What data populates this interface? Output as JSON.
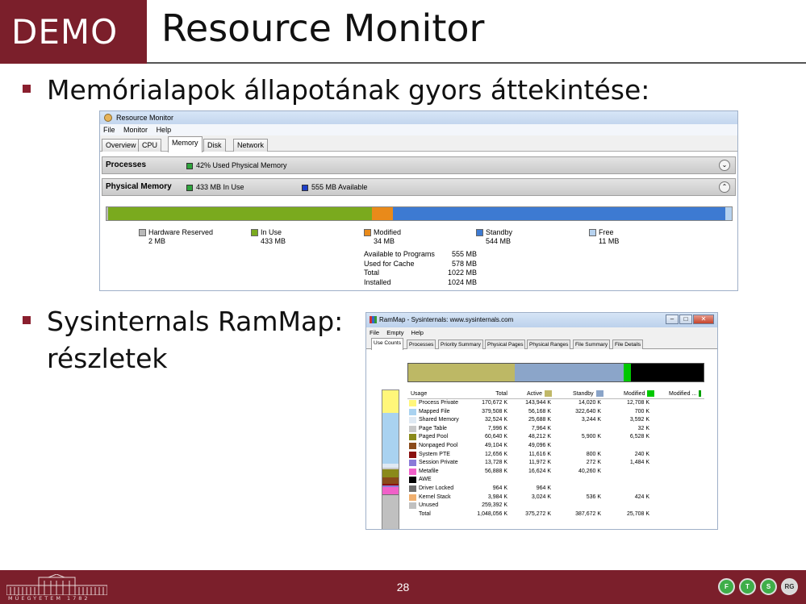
{
  "slide": {
    "demo_label": "DEMO",
    "title": "Resource Monitor",
    "bullet1": "Memórialapok állapotának gyors áttekintése:",
    "bullet2_line1": "Sysinternals RamMap:",
    "bullet2_line2": "részletek",
    "page_number": "28",
    "footer_logo_text": "MŰEGYETEM 1782",
    "footer_icons": [
      "F",
      "T",
      "S",
      "RG"
    ]
  },
  "resource_monitor": {
    "window_title": "Resource Monitor",
    "menu": [
      "File",
      "Monitor",
      "Help"
    ],
    "tabs": [
      "Overview",
      "CPU",
      "Memory",
      "Disk",
      "Network"
    ],
    "active_tab": "Memory",
    "processes_panel": {
      "title": "Processes",
      "legend": "42% Used Physical Memory"
    },
    "physical_panel": {
      "title": "Physical Memory",
      "legend_in_use": "433 MB In Use",
      "legend_available": "555 MB Available"
    },
    "bar_segments": [
      {
        "name": "Hardware Reserved",
        "value_mb": 2,
        "color": "#b9b9b9"
      },
      {
        "name": "In Use",
        "value_mb": 433,
        "color": "#7aaa1e"
      },
      {
        "name": "Modified",
        "value_mb": 34,
        "color": "#e98a1a"
      },
      {
        "name": "Standby",
        "value_mb": 544,
        "color": "#3d7ad2"
      },
      {
        "name": "Free",
        "value_mb": 11,
        "color": "#b6d2ef"
      }
    ],
    "legend": [
      {
        "label": "Hardware Reserved",
        "value": "2 MB"
      },
      {
        "label": "In Use",
        "value": "433 MB"
      },
      {
        "label": "Modified",
        "value": "34 MB"
      },
      {
        "label": "Standby",
        "value": "544 MB"
      },
      {
        "label": "Free",
        "value": "11 MB"
      }
    ],
    "stats": [
      {
        "label": "Available to Programs",
        "value": "555 MB"
      },
      {
        "label": "Used for Cache",
        "value": "578 MB"
      },
      {
        "label": "Total",
        "value": "1022 MB"
      },
      {
        "label": "Installed",
        "value": "1024 MB"
      }
    ]
  },
  "rammap": {
    "window_title": "RamMap - Sysinternals: www.sysinternals.com",
    "menu": [
      "File",
      "Empty",
      "Help"
    ],
    "tabs": [
      "Use Counts",
      "Processes",
      "Priority Summary",
      "Physical Pages",
      "Physical Ranges",
      "File Summary",
      "File Details"
    ],
    "active_tab": "Use Counts",
    "columns": [
      "Usage",
      "Total",
      "Active",
      "Standby",
      "Modified",
      "Modified ..."
    ],
    "column_colors": {
      "active": "#c0b868",
      "standby": "#8aa4c8",
      "modified": "#00c800",
      "modified_nowrite": "#00a000"
    },
    "top_bar": [
      {
        "name": "Active",
        "fraction": 0.36,
        "color": "#bdb865"
      },
      {
        "name": "Standby",
        "fraction": 0.37,
        "color": "#8ba5c9"
      },
      {
        "name": "Modified",
        "fraction": 0.025,
        "color": "#00c800"
      },
      {
        "name": "Free",
        "fraction": 0.245,
        "color": "#000000"
      }
    ],
    "rows": [
      {
        "usage": "Process Private",
        "total": "170,672 K",
        "active": "143,944 K",
        "standby": "14,020 K",
        "modified": "12,708 K",
        "color": "#fff67a"
      },
      {
        "usage": "Mapped File",
        "total": "379,508 K",
        "active": "56,168 K",
        "standby": "322,640 K",
        "modified": "700 K",
        "color": "#a9d2f0"
      },
      {
        "usage": "Shared Memory",
        "total": "32,524 K",
        "active": "25,688 K",
        "standby": "3,244 K",
        "modified": "3,592 K",
        "color": "#dfe9f3"
      },
      {
        "usage": "Page Table",
        "total": "7,996 K",
        "active": "7,964 K",
        "standby": "",
        "modified": "32 K",
        "color": "#c8c8c8"
      },
      {
        "usage": "Paged Pool",
        "total": "60,640 K",
        "active": "48,212 K",
        "standby": "5,900 K",
        "modified": "6,528 K",
        "color": "#8a8a1a"
      },
      {
        "usage": "Nonpaged Pool",
        "total": "49,104 K",
        "active": "49,096 K",
        "standby": "",
        "modified": "",
        "color": "#8a4a1a"
      },
      {
        "usage": "System PTE",
        "total": "12,656 K",
        "active": "11,616 K",
        "standby": "800 K",
        "modified": "240 K",
        "color": "#8a1010"
      },
      {
        "usage": "Session Private",
        "total": "13,728 K",
        "active": "11,972 K",
        "standby": "272 K",
        "modified": "1,484 K",
        "color": "#8a7ad8"
      },
      {
        "usage": "Metafile",
        "total": "56,888 K",
        "active": "16,624 K",
        "standby": "40,260 K",
        "modified": "",
        "color": "#f060c8"
      },
      {
        "usage": "AWE",
        "total": "",
        "active": "",
        "standby": "",
        "modified": "",
        "color": "#000000"
      },
      {
        "usage": "Driver Locked",
        "total": "964 K",
        "active": "964 K",
        "standby": "",
        "modified": "",
        "color": "#707070"
      },
      {
        "usage": "Kernel Stack",
        "total": "3,984 K",
        "active": "3,024 K",
        "standby": "536 K",
        "modified": "424 K",
        "color": "#f0b070"
      },
      {
        "usage": "Unused",
        "total": "259,392 K",
        "active": "",
        "standby": "",
        "modified": "",
        "color": "#c0c0c0"
      },
      {
        "usage": "Total",
        "total": "1,048,056 K",
        "active": "375,272 K",
        "standby": "387,672 K",
        "modified": "25,708 K",
        "color": ""
      }
    ],
    "left_bar": [
      {
        "name": "Process Private",
        "fraction": 0.163,
        "color": "#fff67a"
      },
      {
        "name": "Mapped File",
        "fraction": 0.362,
        "color": "#a9d2f0"
      },
      {
        "name": "Shared Memory",
        "fraction": 0.031,
        "color": "#dfe9f3"
      },
      {
        "name": "Page Table",
        "fraction": 0.008,
        "color": "#c8c8c8"
      },
      {
        "name": "Paged Pool",
        "fraction": 0.058,
        "color": "#8a8a1a"
      },
      {
        "name": "Nonpaged Pool",
        "fraction": 0.047,
        "color": "#8a4a1a"
      },
      {
        "name": "System PTE",
        "fraction": 0.012,
        "color": "#8a1010"
      },
      {
        "name": "Session Private",
        "fraction": 0.013,
        "color": "#8a7ad8"
      },
      {
        "name": "Metafile",
        "fraction": 0.054,
        "color": "#f060c8"
      },
      {
        "name": "Driver Locked",
        "fraction": 0.001,
        "color": "#707070"
      },
      {
        "name": "Kernel Stack",
        "fraction": 0.004,
        "color": "#f0b070"
      },
      {
        "name": "Unused",
        "fraction": 0.247,
        "color": "#c0c0c0"
      }
    ]
  }
}
